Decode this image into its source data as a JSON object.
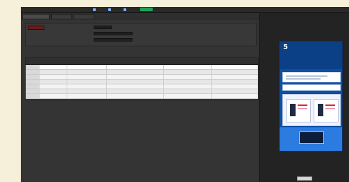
{
  "topbar": {
    "title": "",
    "menus": [
      "",
      "",
      ""
    ]
  },
  "tabs": [
    "",
    "",
    ""
  ],
  "filter": {
    "chip": "",
    "labels": [
      "",
      "",
      ""
    ],
    "values": [
      "",
      "",
      ""
    ]
  },
  "table": {
    "headers": [
      "",
      "",
      "",
      "",
      "",
      ""
    ],
    "rows": [
      [
        "",
        "",
        "",
        "",
        "",
        ""
      ],
      [
        "",
        "",
        "",
        "",
        "",
        ""
      ],
      [
        "",
        "",
        "",
        "",
        "",
        ""
      ],
      [
        "",
        "",
        "",
        "",
        "",
        ""
      ],
      [
        "",
        "",
        "",
        "",
        "",
        ""
      ],
      [
        "",
        "",
        "",
        "",
        "",
        ""
      ],
      [
        "",
        "",
        "",
        "",
        "",
        ""
      ]
    ]
  },
  "right": {
    "header": "",
    "preview": {
      "big": "5",
      "caption": ""
    },
    "button": ""
  }
}
